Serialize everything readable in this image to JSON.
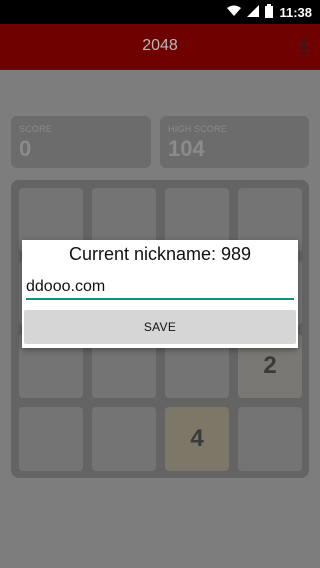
{
  "status_bar": {
    "time": "11:38",
    "icons": [
      "wifi-icon",
      "signal-icon",
      "battery-icon"
    ]
  },
  "app_bar": {
    "title": "2048",
    "menu_icon": "more-vert-icon"
  },
  "scoreboard": {
    "score_label": "SCORE",
    "score_value": "0",
    "high_score_label": "HIGH SCORE",
    "high_score_value": "104"
  },
  "board": {
    "rows": [
      [
        "",
        "",
        "",
        ""
      ],
      [
        "",
        "",
        "",
        ""
      ],
      [
        "",
        "",
        "",
        "2"
      ],
      [
        "",
        "",
        "4",
        ""
      ]
    ]
  },
  "dialog": {
    "title": "Current nickname: 989",
    "input_value": "ddooo.com",
    "save_label": "SAVE"
  },
  "colors": {
    "app_bar": "#6e0000",
    "accent": "#0d8f83",
    "background_dim": "#7d7d7d"
  }
}
